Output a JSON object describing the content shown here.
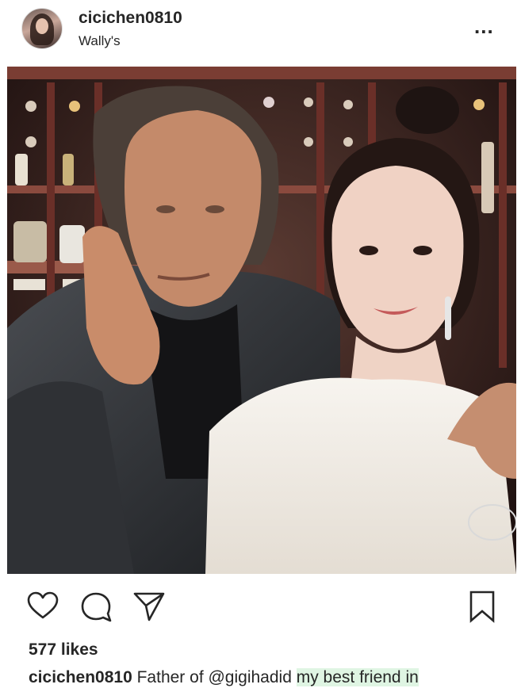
{
  "post": {
    "username": "cicichen0810",
    "location": "Wally's",
    "more_label": "...",
    "likes": "577 likes",
    "caption": {
      "username": "cicichen0810",
      "text": "Father of @gigihadid ",
      "highlight": "my best friend in"
    }
  },
  "icons": [
    "heart-icon",
    "comment-icon",
    "share-icon",
    "bookmark-icon",
    "more-options-icon"
  ],
  "colors": {
    "text": "#262626",
    "background": "#ffffff",
    "caption_highlight": "#dff5e3"
  }
}
